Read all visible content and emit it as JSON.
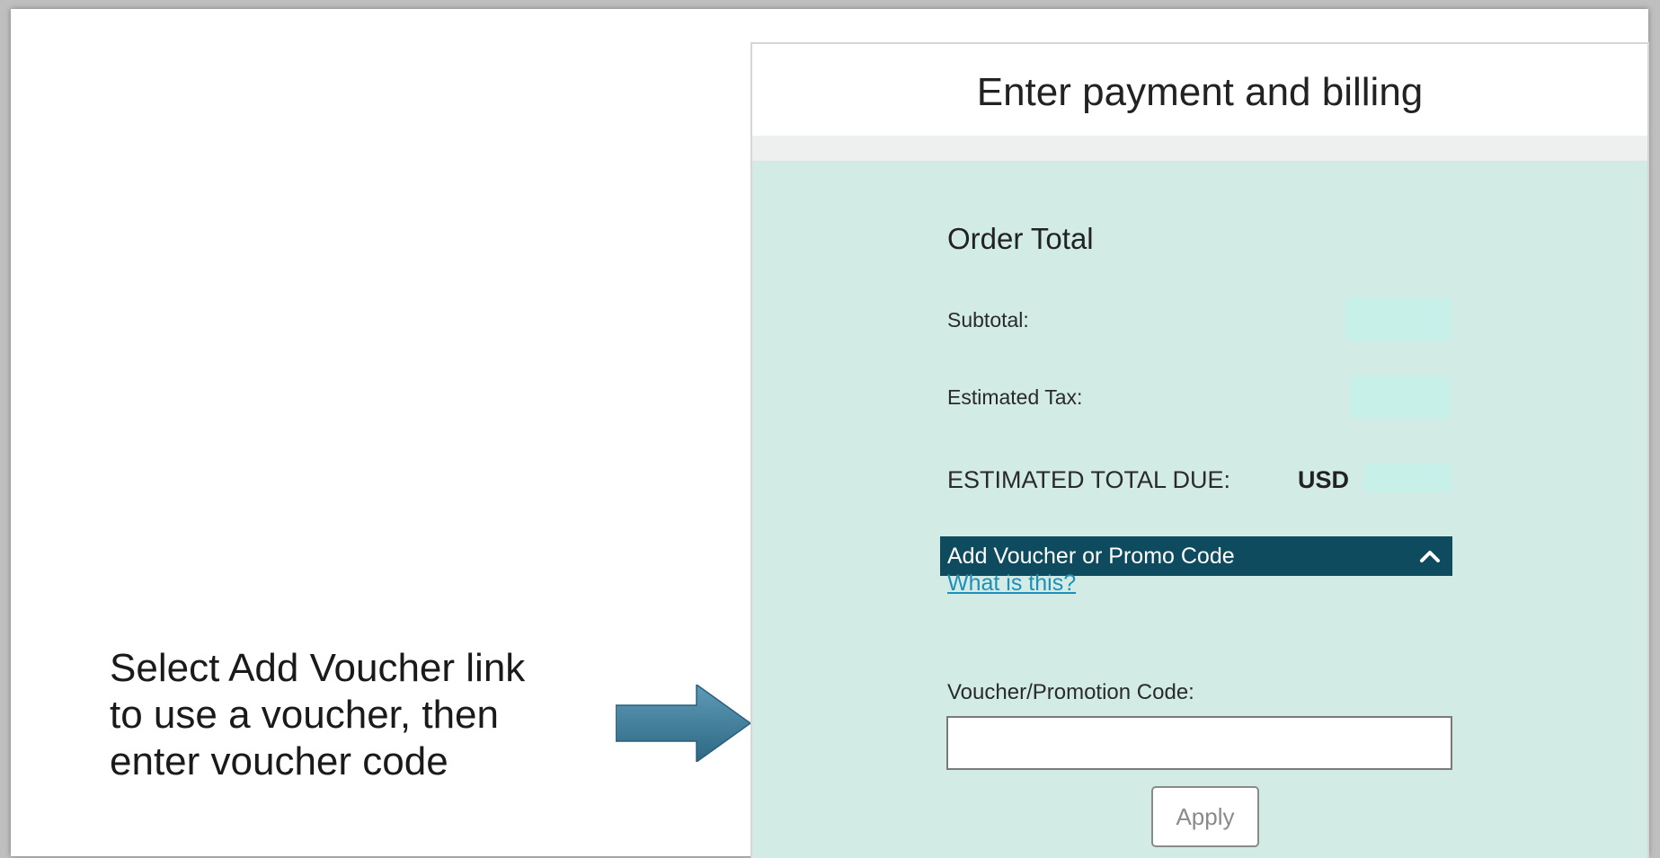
{
  "instruction": {
    "line1": "Select Add Voucher link",
    "line2": "to use a voucher, then",
    "line3": "enter voucher code"
  },
  "panel": {
    "title": "Enter payment and billing",
    "order_total": {
      "heading": "Order Total",
      "subtotal_label": "Subtotal:",
      "subtotal_value": "",
      "tax_label": "Estimated Tax:",
      "tax_value": "",
      "total_label": "ESTIMATED TOTAL DUE:",
      "currency": "USD",
      "total_value": ""
    },
    "voucher": {
      "toggle_label": "Add Voucher or Promo Code",
      "toggle_icon": "chevron-up-icon",
      "help_link": "What is this?",
      "code_label": "Voucher/Promotion Code:",
      "code_value": "",
      "code_placeholder": "",
      "apply_label": "Apply"
    }
  },
  "colors": {
    "panel_background": "#d2ebe5",
    "voucher_bar": "#0f4b5f",
    "link": "#1e8fb8",
    "arrow": "#3d7d9c"
  }
}
